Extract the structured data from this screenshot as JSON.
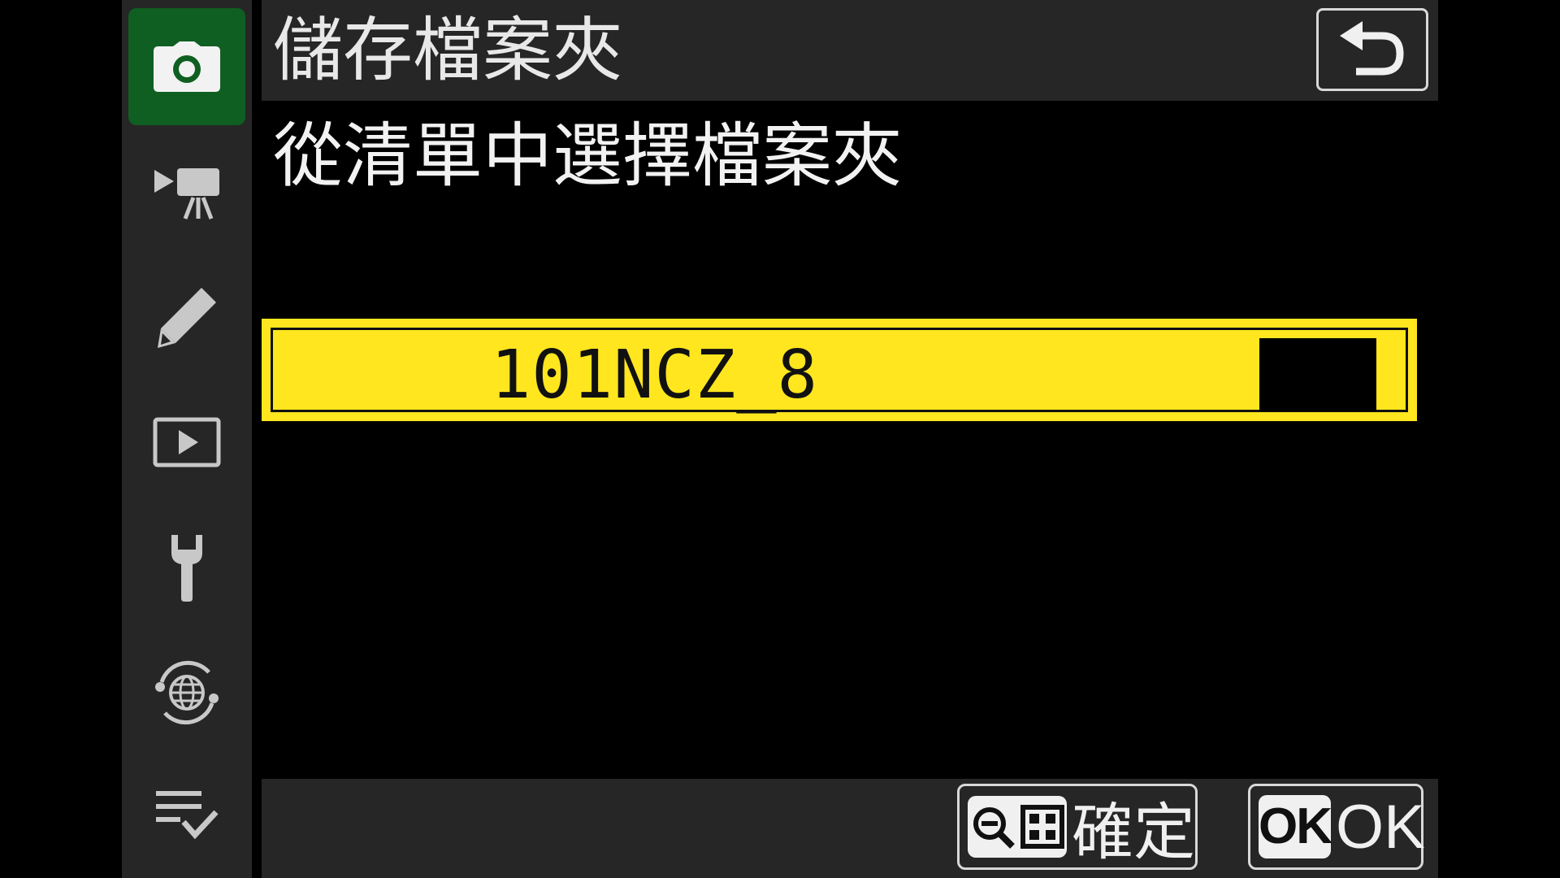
{
  "sidebar": {
    "items": [
      {
        "icon": "camera-icon",
        "active": true
      },
      {
        "icon": "movie-camera-icon",
        "active": false
      },
      {
        "icon": "pencil-icon",
        "active": false
      },
      {
        "icon": "playback-icon",
        "active": false
      },
      {
        "icon": "wrench-icon",
        "active": false
      },
      {
        "icon": "network-globe-icon",
        "active": false
      },
      {
        "icon": "my-menu-check-icon",
        "active": false
      }
    ],
    "active_color": "#0f5f22"
  },
  "header": {
    "title": "儲存檔案夾",
    "back_icon": "return-arrow-icon"
  },
  "prompt": "從清單中選擇檔案夾",
  "folder_field": {
    "value": "101NCZ_8",
    "highlight_color": "#ffe61e"
  },
  "footer": {
    "confirm_label": "確定",
    "confirm_icon": "zoom-out-thumbnail-icon",
    "ok_badge": "OK",
    "ok_label": "OK"
  }
}
